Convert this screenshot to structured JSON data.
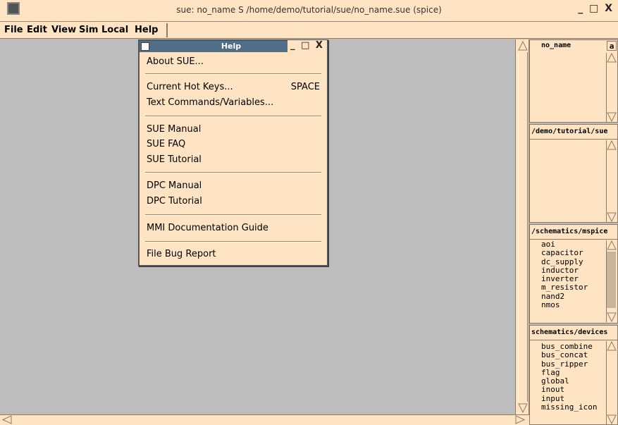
{
  "window": {
    "title": "sue:  no_name S  /home/demo/tutorial/sue/no_name.sue  (spice)",
    "controls": "_ □ X"
  },
  "menubar": [
    "File",
    "Edit",
    "View",
    "Sim",
    "Local",
    "Help"
  ],
  "help_window": {
    "title": "Help",
    "controls": "_ □ X",
    "items": [
      {
        "label": "About SUE..."
      },
      {
        "label": "Current Hot Keys...",
        "key": "SPACE"
      },
      {
        "label": "Text Commands/Variables..."
      },
      {
        "label": "SUE Manual"
      },
      {
        "label": "SUE FAQ"
      },
      {
        "label": "SUE Tutorial"
      },
      {
        "label": "DPC Manual"
      },
      {
        "label": "DPC Tutorial"
      },
      {
        "label": "MMI Documentation Guide"
      },
      {
        "label": "File Bug Report"
      }
    ]
  },
  "panels": {
    "current": {
      "name": "no_name",
      "tag": "a"
    },
    "dir1": {
      "header": "/demo/tutorial/sue",
      "items": []
    },
    "dir2": {
      "header": "/schematics/mspice",
      "items": [
        "aoi",
        "capacitor",
        "dc_supply",
        "inductor",
        "inverter",
        "m_resistor",
        "nand2",
        "nmos"
      ]
    },
    "dir3": {
      "header": "schematics/devices",
      "items": [
        "bus_combine",
        "bus_concat",
        "bus_ripper",
        "flag",
        "global",
        "inout",
        "input",
        "missing_icon"
      ]
    }
  },
  "colors": {
    "bisque": "#ffe4c4",
    "canvas": "#bdbdbd",
    "help_titlebar": "#4f6e87"
  }
}
